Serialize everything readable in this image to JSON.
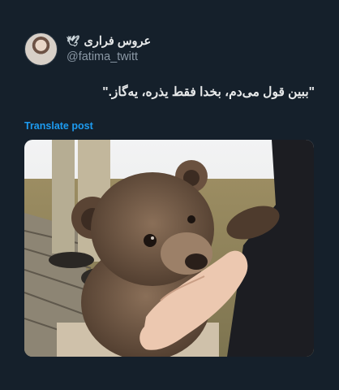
{
  "user": {
    "display_name": "عروس فراری",
    "handle": "@fatima_twitt",
    "badge_icon": "dove-icon"
  },
  "tweet": {
    "text": "\"ببین قول می‌دم، بخدا فقط یذره، یه‌گاز.\"",
    "translate_label": "Translate post"
  },
  "colors": {
    "background": "#15202b",
    "link": "#1d9bf0",
    "muted": "#8b98a5"
  }
}
